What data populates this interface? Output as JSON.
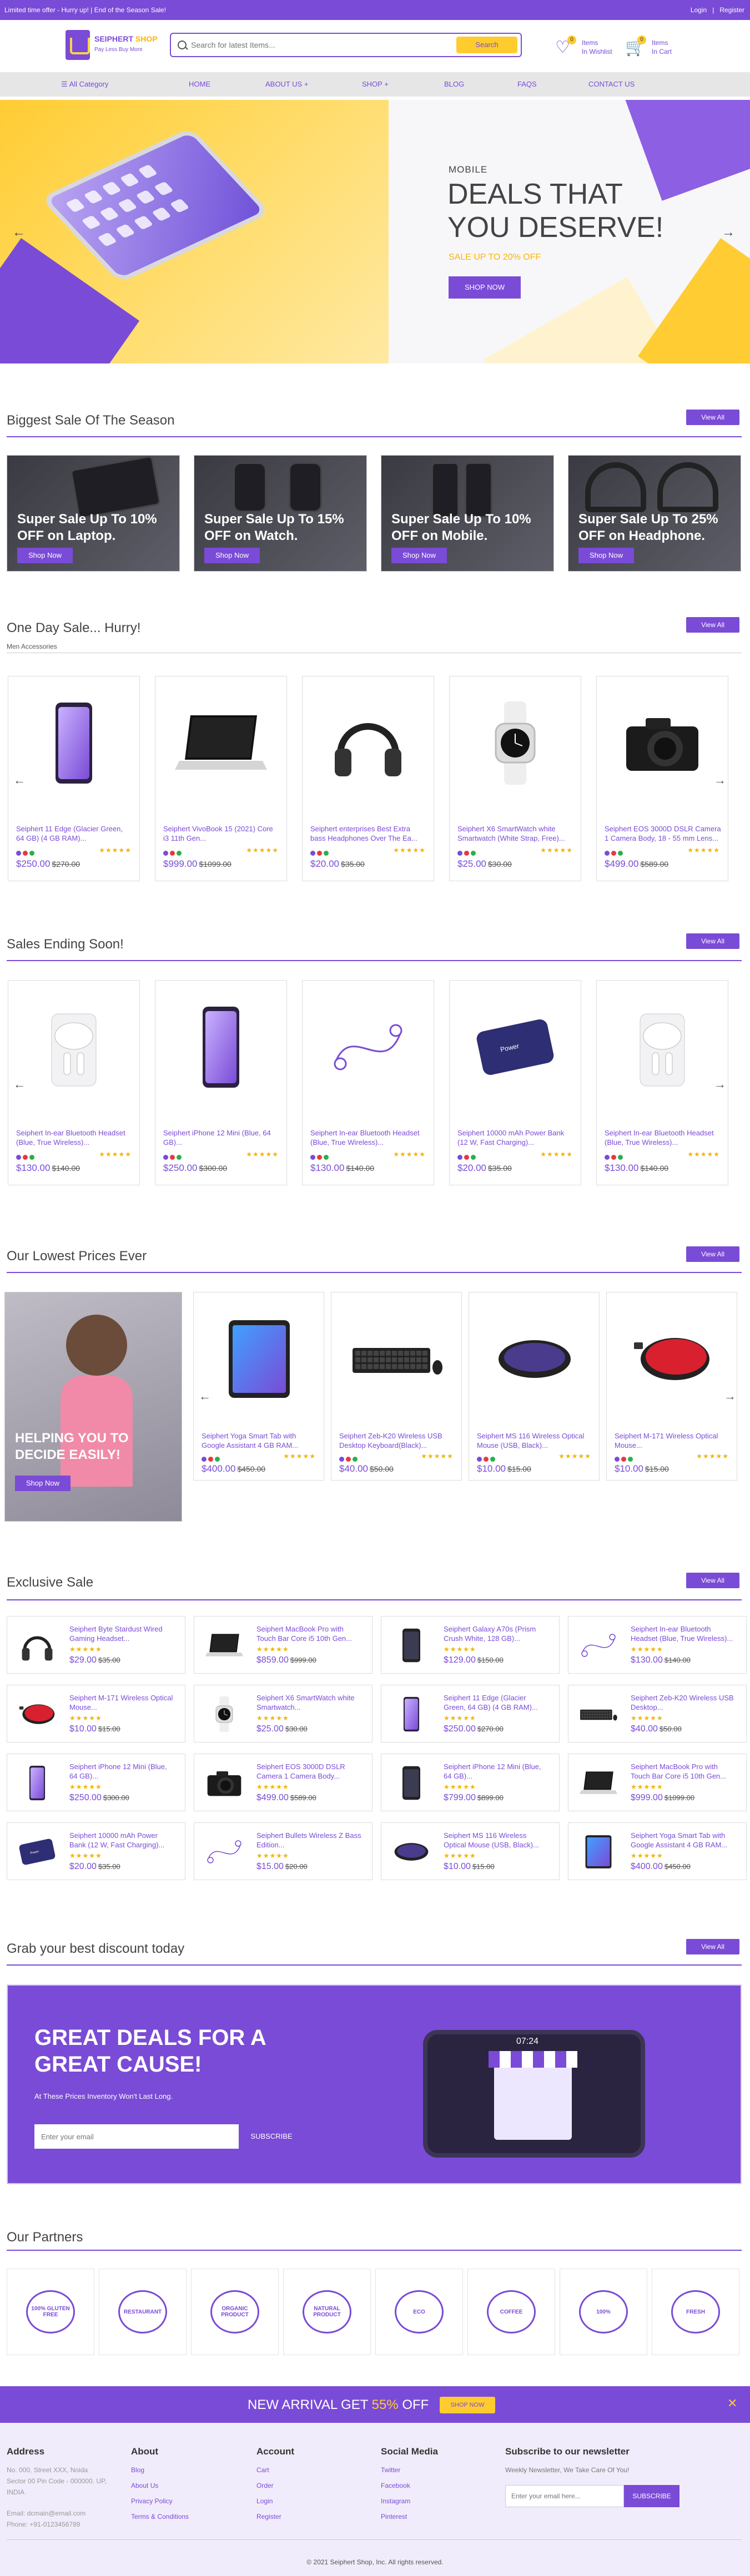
{
  "topbar": {
    "promo": "Limited time offer - Hurry up! | End of the Season Sale!",
    "login": "Login",
    "register": "Register"
  },
  "header": {
    "brand": "SEIPHERT SHOP",
    "brand_a": "SEIPHERT",
    "brand_b": "SHOP",
    "tagline": "Pay Less Buy More",
    "search_placeholder": "Search for latest Items...",
    "search_button": "Search",
    "wishlist_count": "0",
    "wishlist_a": "Items",
    "wishlist_b": "In Wishlist",
    "cart_count": "0",
    "cart_a": "Items",
    "cart_b": "In Cart"
  },
  "nav": {
    "category": "All Category",
    "items": [
      "HOME",
      "ABOUT US +",
      "SHOP +",
      "BLOG",
      "FAQS",
      "CONTACT US"
    ]
  },
  "hero": {
    "subtitle": "MOBILE",
    "title": "DEALS THAT YOU DESERVE!",
    "offer": "SALE UP TO 20% OFF",
    "button": "SHOP NOW"
  },
  "biggest": {
    "title": "Biggest Sale Of The Season",
    "view_all": "View All",
    "promos": [
      {
        "text": "Super Sale Up To 10% OFF on Laptop.",
        "button": "Shop Now"
      },
      {
        "text": "Super Sale Up To 15% OFF on Watch.",
        "button": "Shop Now"
      },
      {
        "text": "Super Sale Up To 10% OFF on Mobile.",
        "button": "Shop Now"
      },
      {
        "text": "Super Sale Up To 25% OFF on Headphone.",
        "button": "Shop Now"
      }
    ]
  },
  "oneday": {
    "title": "One Day Sale... Hurry!",
    "subtitle": "Men Accessories",
    "view_all": "View All",
    "products": [
      {
        "name": "Seiphert 11 Edge (Glacier Green, 64 GB) (4 GB RAM)...",
        "price": "$250.00",
        "old": "$270.00",
        "stars": "★★★★★",
        "icon": "phone"
      },
      {
        "name": "Seiphert VivoBook 15 (2021) Core i3 11th Gen...",
        "price": "$999.00",
        "old": "$1099.00",
        "stars": "★★★★★",
        "icon": "laptop"
      },
      {
        "name": "Seiphert enterprises Best Extra bass Headphones Over The Ea...",
        "price": "$20.00",
        "old": "$35.00",
        "stars": "★★★★★",
        "icon": "headphone"
      },
      {
        "name": "Seiphert X6 SmartWatch white Smartwatch (White Strap, Free)...",
        "price": "$25.00",
        "old": "$30.00",
        "stars": "★★★★★",
        "icon": "watch"
      },
      {
        "name": "Seiphert EOS 3000D DSLR Camera 1 Camera Body, 18 - 55 mm Lens...",
        "price": "$499.00",
        "old": "$589.00",
        "stars": "★★★★★",
        "icon": "camera"
      }
    ]
  },
  "ending": {
    "title": "Sales Ending Soon!",
    "view_all": "View All",
    "products": [
      {
        "name": "Seiphert In-ear Bluetooth Headset (Blue, True Wireless)...",
        "price": "$130.00",
        "old": "$140.00",
        "stars": "★★★★★",
        "icon": "earbuds"
      },
      {
        "name": "Seiphert iPhone 12 Mini (Blue, 64 GB)...",
        "price": "$250.00",
        "old": "$300.00",
        "stars": "★★★★★",
        "icon": "phone"
      },
      {
        "name": "Seiphert In-ear Bluetooth Headset (Blue, True Wireless)...",
        "price": "$130.00",
        "old": "$140.00",
        "stars": "★★★★★",
        "icon": "cable"
      },
      {
        "name": "Seiphert 10000 mAh Power Bank (12 W, Fast Charging)...",
        "price": "$20.00",
        "old": "$35.00",
        "stars": "★★★★★",
        "icon": "powerbank"
      },
      {
        "name": "Seiphert In-ear Bluetooth Headset (Blue, True Wireless)...",
        "price": "$130.00",
        "old": "$140.00",
        "stars": "★★★★★",
        "icon": "earbuds"
      }
    ]
  },
  "lowest": {
    "title": "Our Lowest Prices Ever",
    "view_all": "View All",
    "banner_text": "HELPING YOU TO DECIDE EASILY!",
    "banner_button": "Shop Now",
    "products": [
      {
        "name": "Seiphert Yoga Smart Tab with Google Assistant 4 GB RAM...",
        "price": "$400.00",
        "old": "$450.00",
        "stars": "★★★★★",
        "icon": "tablet"
      },
      {
        "name": "Seiphert Zeb-K20 Wireless USB Desktop Keyboard(Black)...",
        "price": "$40.00",
        "old": "$50.00",
        "stars": "★★★★★",
        "icon": "keyboard"
      },
      {
        "name": "Seiphert MS 116 Wireless Optical Mouse (USB, Black)...",
        "price": "$10.00",
        "old": "$15.00",
        "stars": "★★★★★",
        "icon": "mouse-dark"
      },
      {
        "name": "Seiphert M-171 Wireless Optical Mouse...",
        "price": "$10.00",
        "old": "$15.00",
        "stars": "★★★★★",
        "icon": "mouse-red"
      }
    ]
  },
  "exclusive": {
    "title": "Exclusive Sale",
    "view_all": "View All",
    "items": [
      {
        "name": "Seiphert Byte Stardust Wired Gaming Headset...",
        "price": "$29.00",
        "old": "$35.00",
        "stars": "★★★★★",
        "icon": "headphone"
      },
      {
        "name": "Seiphert MacBook Pro with Touch Bar Core i5 10th Gen...",
        "price": "$859.00",
        "old": "$999.00",
        "stars": "★★★★★",
        "icon": "laptop"
      },
      {
        "name": "Seiphert Galaxy A70s (Prism Crush White, 128 GB)...",
        "price": "$129.00",
        "old": "$150.00",
        "stars": "★★★★★",
        "icon": "phone-dark"
      },
      {
        "name": "Seiphert In-ear Bluetooth Headset (Blue, True Wireless)...",
        "price": "$130.00",
        "old": "$140.00",
        "stars": "★★★★★",
        "icon": "cable"
      },
      {
        "name": "Seiphert M-171 Wireless Optical Mouse...",
        "price": "$10.00",
        "old": "$15.00",
        "stars": "★★★★★",
        "icon": "mouse-red"
      },
      {
        "name": "Seiphert X6 SmartWatch white Smartwatch...",
        "price": "$25.00",
        "old": "$30.00",
        "stars": "★★★★★",
        "icon": "watch"
      },
      {
        "name": "Seiphert 11 Edge (Glacier Green, 64 GB) (4 GB RAM)...",
        "price": "$250.00",
        "old": "$270.00",
        "stars": "★★★★★",
        "icon": "phone"
      },
      {
        "name": "Seiphert Zeb-K20 Wireless USB Desktop...",
        "price": "$40.00",
        "old": "$50.00",
        "stars": "★★★★★",
        "icon": "keyboard"
      },
      {
        "name": "Seiphert iPhone 12 Mini (Blue, 64 GB)...",
        "price": "$250.00",
        "old": "$300.00",
        "stars": "★★★★★",
        "icon": "phone"
      },
      {
        "name": "Seiphert EOS 3000D DSLR Camera 1 Camera Body...",
        "price": "$499.00",
        "old": "$589.00",
        "stars": "★★★★★",
        "icon": "camera"
      },
      {
        "name": "Seiphert iPhone 12 Mini (Blue, 64 GB)...",
        "price": "$799.00",
        "old": "$899.00",
        "stars": "★★★★★",
        "icon": "phone-dark"
      },
      {
        "name": "Seiphert MacBook Pro with Touch Bar Core i5 10th Gen...",
        "price": "$999.00",
        "old": "$1099.00",
        "stars": "★★★★★",
        "icon": "laptop"
      },
      {
        "name": "Seiphert 10000 mAh Power Bank (12 W, Fast Charging)...",
        "price": "$20.00",
        "old": "$35.00",
        "stars": "★★★★★",
        "icon": "powerbank"
      },
      {
        "name": "Seiphert Bullets Wireless Z Bass Edition...",
        "price": "$15.00",
        "old": "$20.00",
        "stars": "★★★★★",
        "icon": "cable"
      },
      {
        "name": "Seiphert MS 116 Wireless Optical Mouse (USB, Black)...",
        "price": "$10.00",
        "old": "$15.00",
        "stars": "★★★★★",
        "icon": "mouse-dark"
      },
      {
        "name": "Seiphert Yoga Smart Tab with Google Assistant 4 GB RAM...",
        "price": "$400.00",
        "old": "$450.00",
        "stars": "★★★★★",
        "icon": "tablet"
      }
    ]
  },
  "discount": {
    "title": "Grab your best discount today",
    "view_all": "View All",
    "banner_title": "GREAT DEALS FOR A GREAT CAUSE!",
    "banner_sub": "At These Prices Inventory Won't Last Long.",
    "email_placeholder": "Enter your email",
    "subscribe": "SUBSCRIBE",
    "clock": "07:24"
  },
  "partners": {
    "title": "Our Partners",
    "items": [
      "100% GLUTEN FREE",
      "RESTAURANT",
      "ORGANIC PRODUCT",
      "NATURAL PRODUCT",
      "ECO",
      "COFFEE",
      "100%",
      "FRESH"
    ]
  },
  "arrival": {
    "text_a": "NEW ARRIVAL GET ",
    "percent": "55%",
    "text_b": " OFF",
    "button": "SHOP NOW",
    "close": "✕"
  },
  "footer": {
    "address": {
      "title": "Address",
      "line1": "No. 000, Street XXX, Noida",
      "line2": "Sector 00 Pin Code - 000000. UP,",
      "line3": "INDIA",
      "email": "Email: dcmain@email.com",
      "phone": "Phone: +91-0123456789"
    },
    "about": {
      "title": "About",
      "links": [
        "Blog",
        "About Us",
        "Privacy Policy",
        "Terms & Conditions"
      ]
    },
    "account": {
      "title": "Account",
      "links": [
        "Cart",
        "Order",
        "Login",
        "Register"
      ]
    },
    "social": {
      "title": "Social Media",
      "links": [
        "Twitter",
        "Facebook",
        "Instagram",
        "Pinterest"
      ]
    },
    "newsletter": {
      "title": "Subscribe to our newsletter",
      "sub": "Weekly Newsletter, We Take Care Of You!",
      "placeholder": "Enter your email here...",
      "button": "SUBSCRIBE"
    },
    "copyright": "© 2021 Seiphert Shop, Inc. All rights reserved."
  },
  "colors": {
    "brand": "#7a4bd6",
    "accent": "#ffcb2f",
    "text": "#333333"
  }
}
